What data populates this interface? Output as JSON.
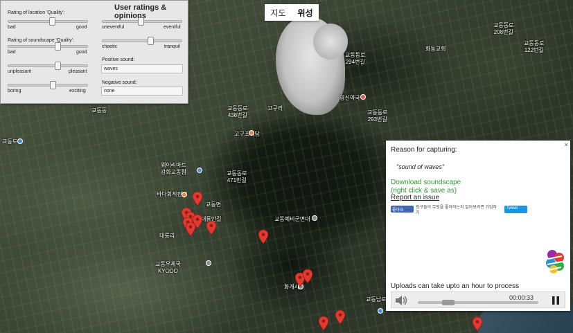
{
  "map_toggle": {
    "map_label": "지도",
    "satellite_label": "위성",
    "active": "satellite"
  },
  "ratings_panel": {
    "title": "User ratings & opinions",
    "location_quality": {
      "label": "Rating of location 'Quality':",
      "low": "bad",
      "high": "good",
      "value": 0.55
    },
    "soundscape_quality": {
      "label": "Rating of soundscape 'Quality':",
      "low": "bad",
      "high": "good",
      "value": 0.62
    },
    "pleasantness": {
      "low": "unpleasant",
      "high": "pleasant",
      "value": 0.62
    },
    "excitement": {
      "low": "boring",
      "high": "exciting",
      "value": 0.56
    },
    "eventfulness": {
      "low": "uneventful",
      "high": "eventful",
      "value": 0.48
    },
    "calmness": {
      "low": "chaotic",
      "high": "tranquil",
      "value": 0.6
    },
    "positive_sound": {
      "label": "Positive sound:",
      "value": "waves"
    },
    "negative_sound": {
      "label": "Negative sound:",
      "value": "none"
    }
  },
  "popup": {
    "close_label": "×",
    "reason_title": "Reason for capturing:",
    "reason_text": "\"sound of waves\"",
    "download_line1": "Download soundscape",
    "download_line2": "(right click & save as)",
    "report_label": "Report an issue",
    "fb_like_label": "좋아요",
    "fb_text": "친구들이 무엇을 좋아하는지 알아보려면 가입하기",
    "tweet_label": "Tweet",
    "upload_note": "Uploads can take upto an hour to process",
    "player": {
      "time": "00:00:33",
      "progress": 0.2
    }
  },
  "map_labels": [
    {
      "text": "교동동로\n294번길"
    },
    {
      "text": "교동동로\n208번길"
    },
    {
      "text": "교동동로\n122번길"
    },
    {
      "text": "교동동로\n438번길"
    },
    {
      "text": "고구리"
    },
    {
      "text": "교동동로\n293번길"
    },
    {
      "text": "교동도"
    },
    {
      "text": "고구초식당"
    },
    {
      "text": "웨이리마트\n강화교동점"
    },
    {
      "text": "교동동로\n471번길"
    },
    {
      "text": "바다회직판장"
    },
    {
      "text": "교동면"
    },
    {
      "text": "대룡안길"
    },
    {
      "text": "교동예비군면대"
    },
    {
      "text": "대룡리"
    },
    {
      "text": "교동우체국\nKYODO"
    },
    {
      "text": "화개사"
    },
    {
      "text": "교동남로"
    },
    {
      "text": "화동교회"
    },
    {
      "text": "영신약국"
    },
    {
      "text": "교동동"
    }
  ],
  "colors": {
    "pin": "#e03a31",
    "download_link": "#2f9a2f",
    "facebook": "#4267b2",
    "twitter": "#1b95e0"
  }
}
